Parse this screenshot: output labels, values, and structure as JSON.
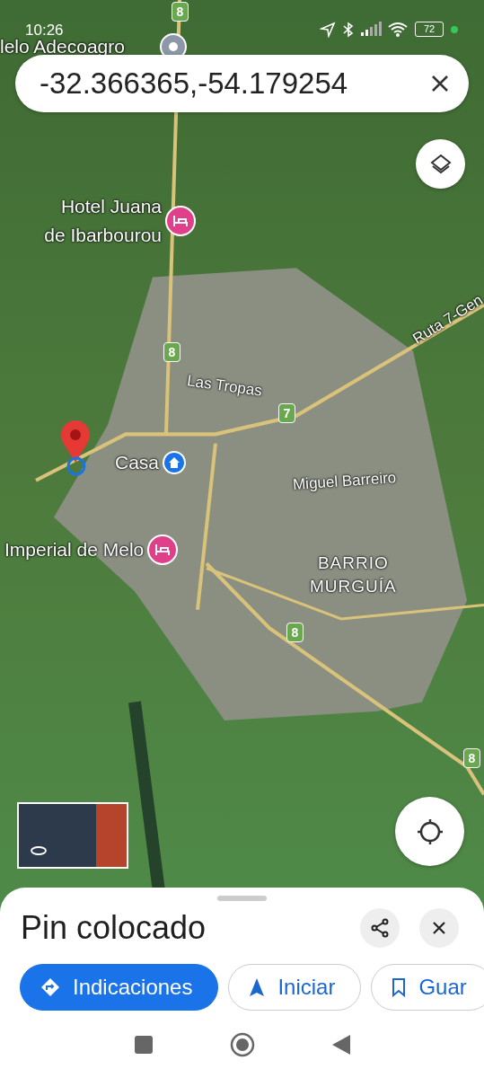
{
  "status_bar": {
    "time": "10:26",
    "battery": "72"
  },
  "search": {
    "value": "-32.366365,-54.179254"
  },
  "map_labels": [
    {
      "kind": "shield",
      "text": "8"
    },
    {
      "kind": "place",
      "text": "lelo Adecoagro"
    },
    {
      "kind": "hotel",
      "text": "Hotel Juana\nde Ibarbourou"
    },
    {
      "kind": "shield",
      "text": "8"
    },
    {
      "kind": "road",
      "text": "Las Tropas"
    },
    {
      "kind": "shield",
      "text": "7"
    },
    {
      "kind": "road",
      "text": "Ruta 7-Gen"
    },
    {
      "kind": "home",
      "text": "Casa"
    },
    {
      "kind": "road",
      "text": "Miguel Barreiro"
    },
    {
      "kind": "hotel",
      "text": "Imperial de Melo"
    },
    {
      "kind": "area",
      "text": "BARRIO\nMURGUÍA"
    },
    {
      "kind": "shield",
      "text": "8"
    },
    {
      "kind": "shield",
      "text": "8"
    }
  ],
  "sheet": {
    "title": "Pin colocado",
    "actions": [
      {
        "kind": "directions",
        "label": "Indicaciones",
        "selected": true
      },
      {
        "kind": "start",
        "label": "Iniciar",
        "selected": false
      },
      {
        "kind": "save",
        "label": "Guar",
        "selected": false
      }
    ]
  }
}
